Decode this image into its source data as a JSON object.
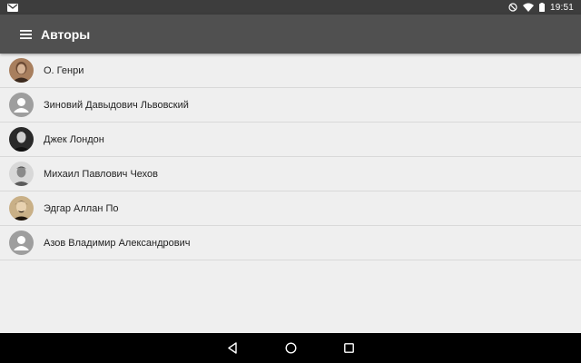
{
  "status_bar": {
    "time": "19:51",
    "icons": [
      "gmail-icon",
      "do-not-disturb-icon",
      "wifi-icon",
      "battery-icon"
    ]
  },
  "toolbar": {
    "title": "Авторы",
    "menu_icon": "hamburger-menu-icon"
  },
  "authors": [
    {
      "name": "О. Генри",
      "avatar": "photo"
    },
    {
      "name": "Зиновий Давыдович Львовский",
      "avatar": "placeholder"
    },
    {
      "name": "Джек Лондон",
      "avatar": "photo"
    },
    {
      "name": "Михаил Павлович Чехов",
      "avatar": "photo"
    },
    {
      "name": "Эдгар Аллан По",
      "avatar": "photo"
    },
    {
      "name": "Азов Владимир Александрович",
      "avatar": "placeholder"
    }
  ],
  "nav_bar": {
    "buttons": [
      "back-icon",
      "home-icon",
      "recents-icon"
    ]
  },
  "colors": {
    "status_bar": "#3d3d3d",
    "toolbar": "#505050",
    "background": "#efefef",
    "divider": "#d9d9d9",
    "placeholder_avatar": "#9e9e9e",
    "nav_bar": "#000000"
  }
}
